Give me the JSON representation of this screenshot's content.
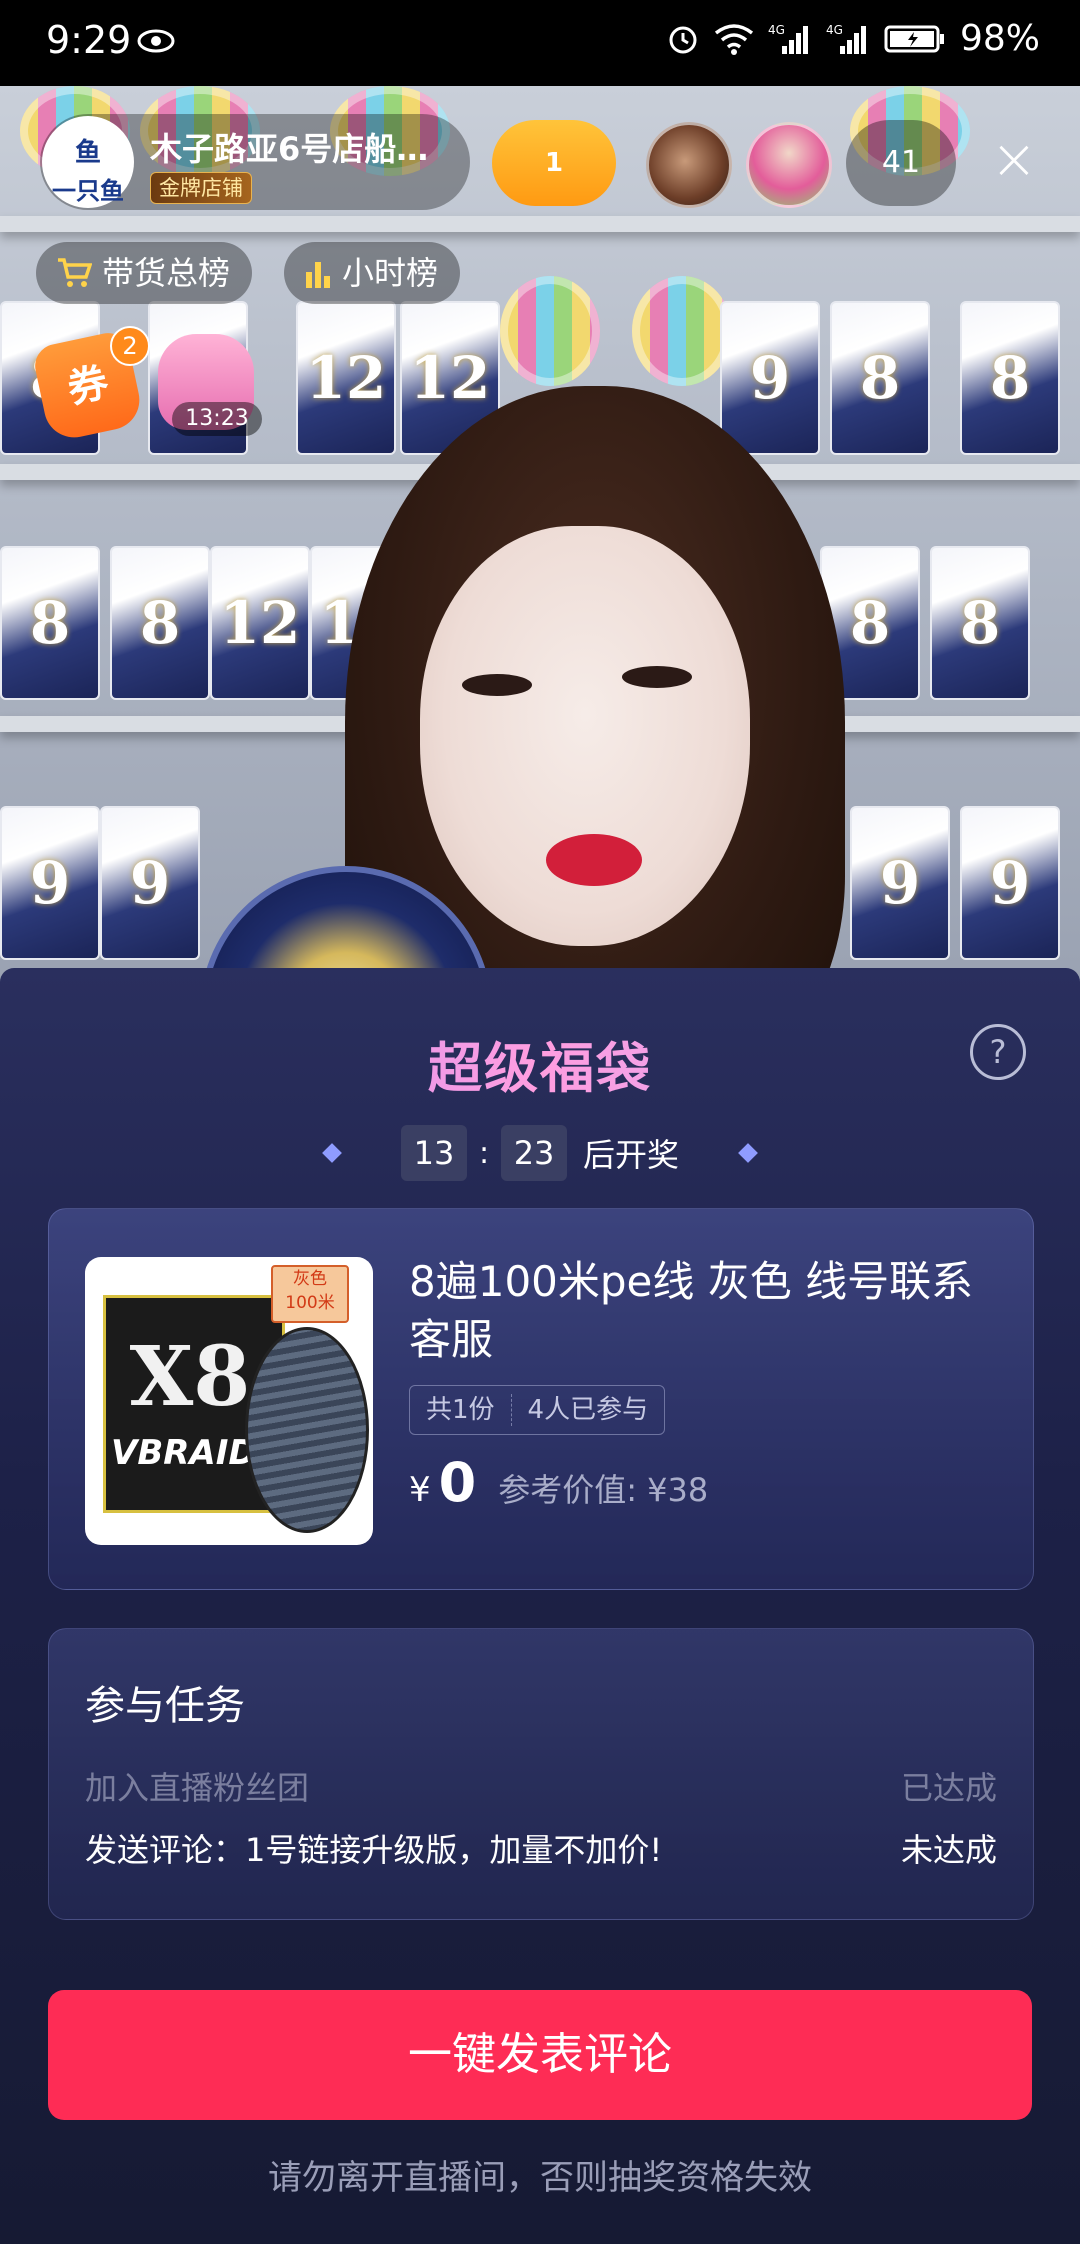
{
  "status_bar": {
    "time": "9:29",
    "battery": "98%",
    "network": "4G"
  },
  "anchor": {
    "name": "木子路亚6号店船…",
    "badge": "金牌店铺",
    "avatar_text_top": "鱼",
    "avatar_text_bottom": "一只鱼"
  },
  "fan_club_level": "1",
  "viewer_count": "41",
  "chips": {
    "sales_rank": "带货总榜",
    "hour_rank": "小时榜"
  },
  "coupon": {
    "label": "券",
    "count": "2"
  },
  "lucky_bag_timer": "13:23",
  "sheet": {
    "title": "超级福袋",
    "countdown_min": "13",
    "countdown_sec": "23",
    "countdown_suffix": "后开奖",
    "prize": {
      "title": "8遍100米pe线 灰色 线号联系客服",
      "total": "共1份",
      "participants": "4人已参与",
      "currency": "¥",
      "price": "0",
      "reference": "参考价值: ¥38",
      "image_tag_line1": "灰色",
      "image_tag_line2": "100米",
      "image_brand": "VBRAID",
      "image_model": "X8"
    },
    "tasks": {
      "title": "参与任务",
      "items": [
        {
          "label": "加入直播粉丝团",
          "status": "已达成"
        },
        {
          "label": "发送评论：1号链接升级版，加量不加价!",
          "status": "未达成"
        }
      ]
    },
    "cta": "一键发表评论",
    "footnote": "请勿离开直播间，否则抽奖资格失效"
  },
  "colors": {
    "cta": "#fe2c55",
    "sheet_bg": "#1d2148",
    "gold_badge": "#e8b34f"
  }
}
